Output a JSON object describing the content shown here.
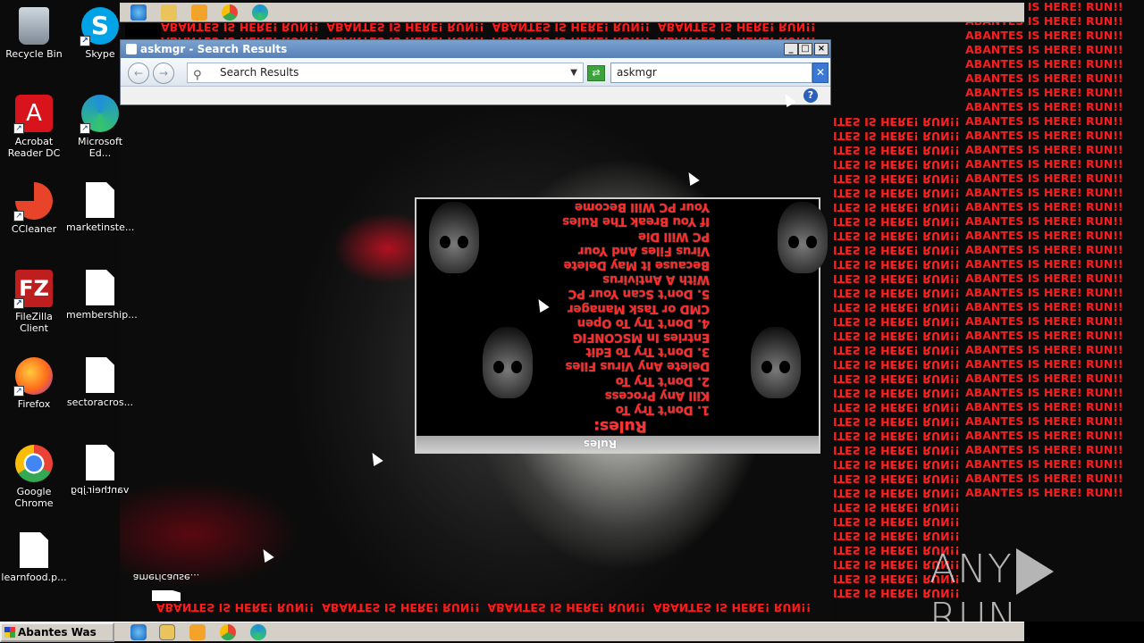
{
  "desktop": {
    "icons": [
      {
        "label": "Recycle Bin"
      },
      {
        "label": "Skype"
      },
      {
        "label": "Acrobat Reader DC"
      },
      {
        "label": "Microsoft Ed..."
      },
      {
        "label": "CCleaner"
      },
      {
        "label": "marketinste..."
      },
      {
        "label": "FileZilla Client"
      },
      {
        "label": "membership..."
      },
      {
        "label": "Firefox"
      },
      {
        "label": "sectoracros..."
      },
      {
        "label": "Google Chrome"
      },
      {
        "label": "vantheir.jpg"
      },
      {
        "label": "learnfood.p..."
      },
      {
        "label": "americause..."
      }
    ]
  },
  "spam_text": "ABANTES IS HERE! RUN!!",
  "spam_text_cut": "ITES IS HERE! RUN!!",
  "explorer": {
    "title": "askmgr - Search Results",
    "address": "Search Results",
    "search_value": "askmgr",
    "help_label": "?"
  },
  "rules_window": {
    "title": "Rules",
    "heading": "Rules:",
    "lines": [
      "1. Don't Try To",
      "Kill Any Process",
      "2. Don't Try To",
      "Delete Any Virus Files",
      "3. Don't Try To Edit",
      "Entries In MSCONFIG",
      "4. Don't Try To Open",
      "CMD or Task Manager",
      "5. Don't Scan Your PC",
      "With A Antivirus",
      "Because It May Delete",
      "Virus Files And Your",
      "PC Will Die",
      "If You Break The Rules",
      "Your PC Will Become"
    ]
  },
  "taskbar": {
    "start_label": "Abantes Was Here"
  },
  "watermark": {
    "left": "ANY",
    "right": "RUN"
  },
  "colors": {
    "spam_red": "#ff1a1a",
    "rules_red": "#ff2a2a",
    "taskbar": "#d4d0c8"
  }
}
